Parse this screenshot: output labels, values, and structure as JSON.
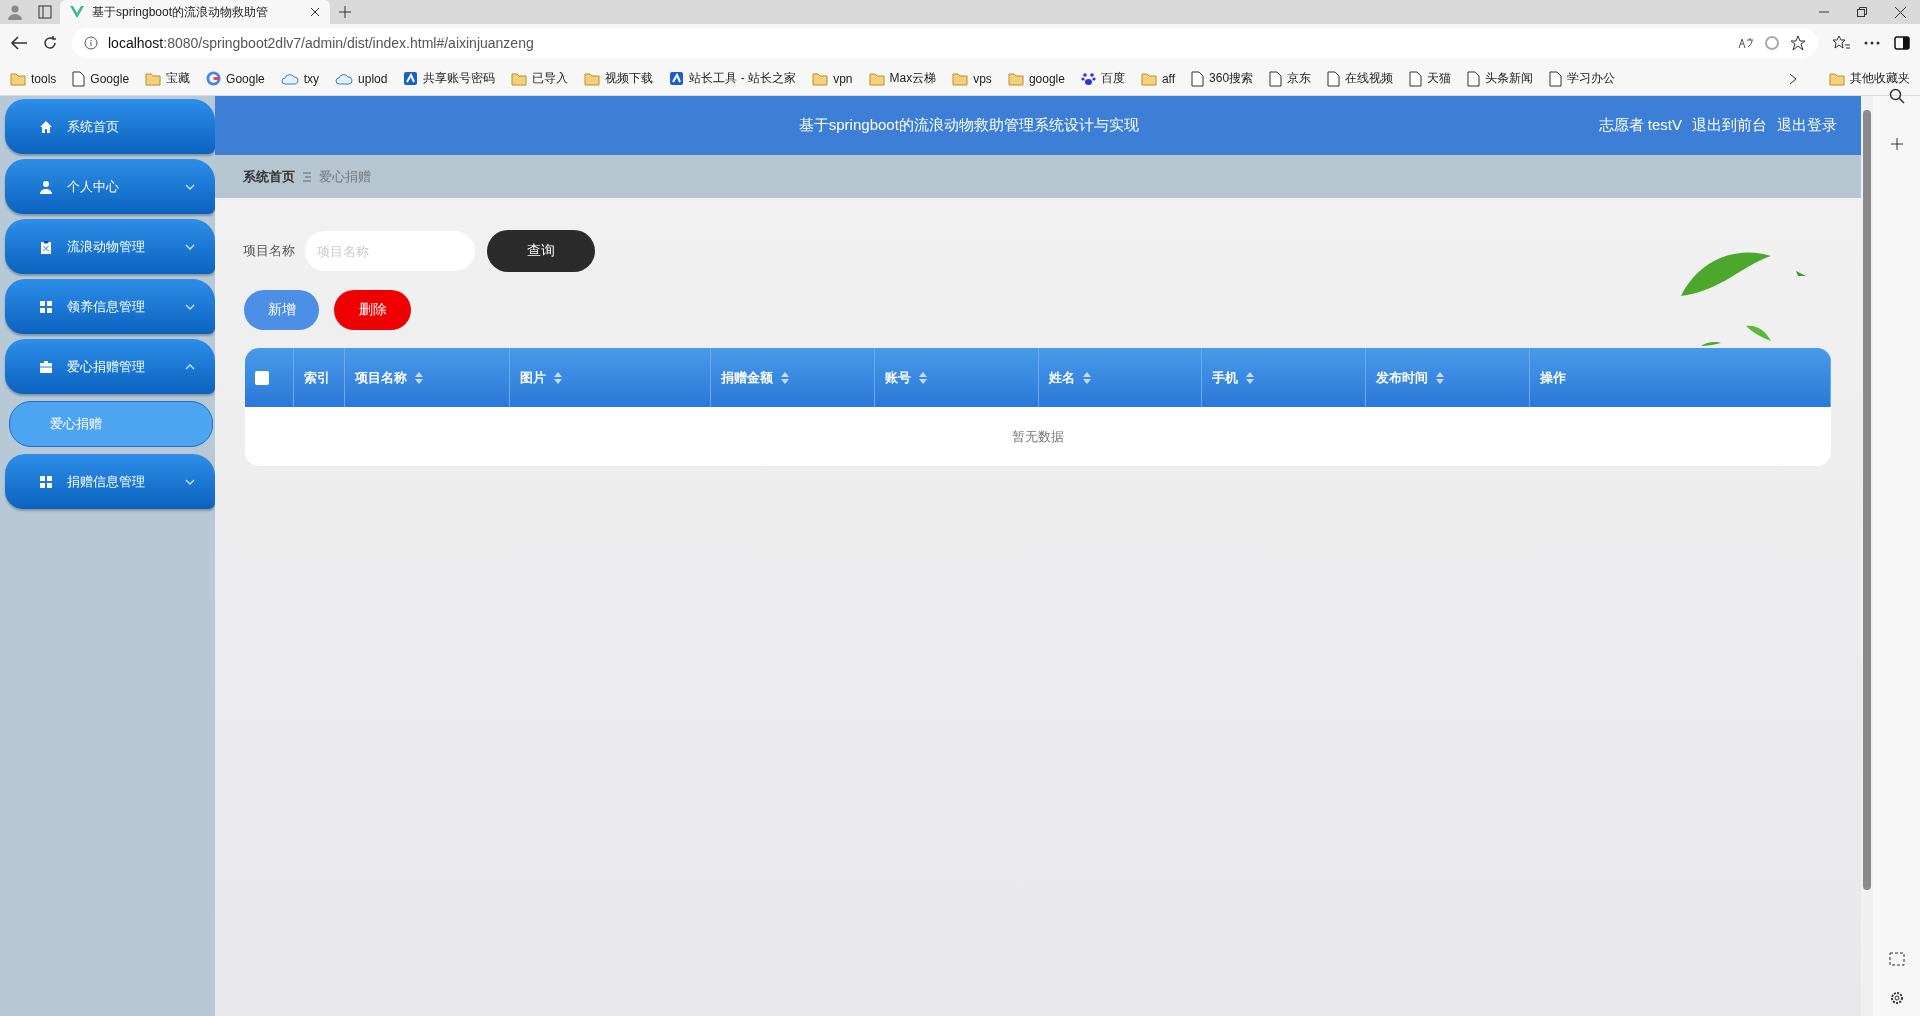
{
  "browser": {
    "tab_title": "基于springboot的流浪动物救助管",
    "url_host": "localhost",
    "url_rest": ":8080/springboot2dlv7/admin/dist/index.html#/aixinjuanzeng",
    "bookmarks": [
      {
        "label": "tools",
        "kind": "folder"
      },
      {
        "label": "Google",
        "kind": "page"
      },
      {
        "label": "宝藏",
        "kind": "folder"
      },
      {
        "label": "Google",
        "kind": "g"
      },
      {
        "label": "txy",
        "kind": "cloud"
      },
      {
        "label": "uplod",
        "kind": "cloud"
      },
      {
        "label": "共享账号密码",
        "kind": "app"
      },
      {
        "label": "已导入",
        "kind": "folder"
      },
      {
        "label": "视频下载",
        "kind": "folder"
      },
      {
        "label": "站长工具 - 站长之家",
        "kind": "app"
      },
      {
        "label": "vpn",
        "kind": "folder"
      },
      {
        "label": "Max云梯",
        "kind": "folder"
      },
      {
        "label": "vps",
        "kind": "folder"
      },
      {
        "label": "google",
        "kind": "folder"
      },
      {
        "label": "百度",
        "kind": "paw"
      },
      {
        "label": "aff",
        "kind": "folder"
      },
      {
        "label": "360搜索",
        "kind": "page"
      },
      {
        "label": "京东",
        "kind": "page"
      },
      {
        "label": "在线视频",
        "kind": "page"
      },
      {
        "label": "天猫",
        "kind": "page"
      },
      {
        "label": "头条新闻",
        "kind": "page"
      },
      {
        "label": "学习办公",
        "kind": "page"
      }
    ],
    "other_bookmarks": "其他收藏夹"
  },
  "sidebar": {
    "items": [
      {
        "label": "系统首页",
        "kind": "link"
      },
      {
        "label": "个人中心",
        "kind": "group",
        "expanded": false
      },
      {
        "label": "流浪动物管理",
        "kind": "group",
        "expanded": false
      },
      {
        "label": "领养信息管理",
        "kind": "group",
        "expanded": false
      },
      {
        "label": "爱心捐赠管理",
        "kind": "group",
        "expanded": true,
        "children": [
          {
            "label": "爱心捐赠",
            "selected": true
          }
        ]
      },
      {
        "label": "捐赠信息管理",
        "kind": "group",
        "expanded": false
      }
    ]
  },
  "header": {
    "title": "基于springboot的流浪动物救助管理系统设计与实现",
    "user": "志愿者 testV",
    "links": [
      "退出到前台",
      "退出登录"
    ]
  },
  "breadcrumb": [
    "系统首页",
    "爱心捐赠"
  ],
  "search": {
    "label": "项目名称",
    "placeholder": "项目名称",
    "button": "查询"
  },
  "actions": [
    {
      "label": "新增",
      "kind": "add"
    },
    {
      "label": "删除",
      "kind": "delete"
    }
  ],
  "table": {
    "select_all_checked": false,
    "columns": [
      {
        "label": "索引",
        "sortable": false
      },
      {
        "label": "项目名称",
        "sortable": true
      },
      {
        "label": "图片",
        "sortable": true
      },
      {
        "label": "捐赠金额",
        "sortable": true
      },
      {
        "label": "账号",
        "sortable": true
      },
      {
        "label": "姓名",
        "sortable": true
      },
      {
        "label": "手机",
        "sortable": true
      },
      {
        "label": "发布时间",
        "sortable": true
      },
      {
        "label": "操作",
        "sortable": false
      }
    ],
    "empty_text": "暂无数据"
  }
}
